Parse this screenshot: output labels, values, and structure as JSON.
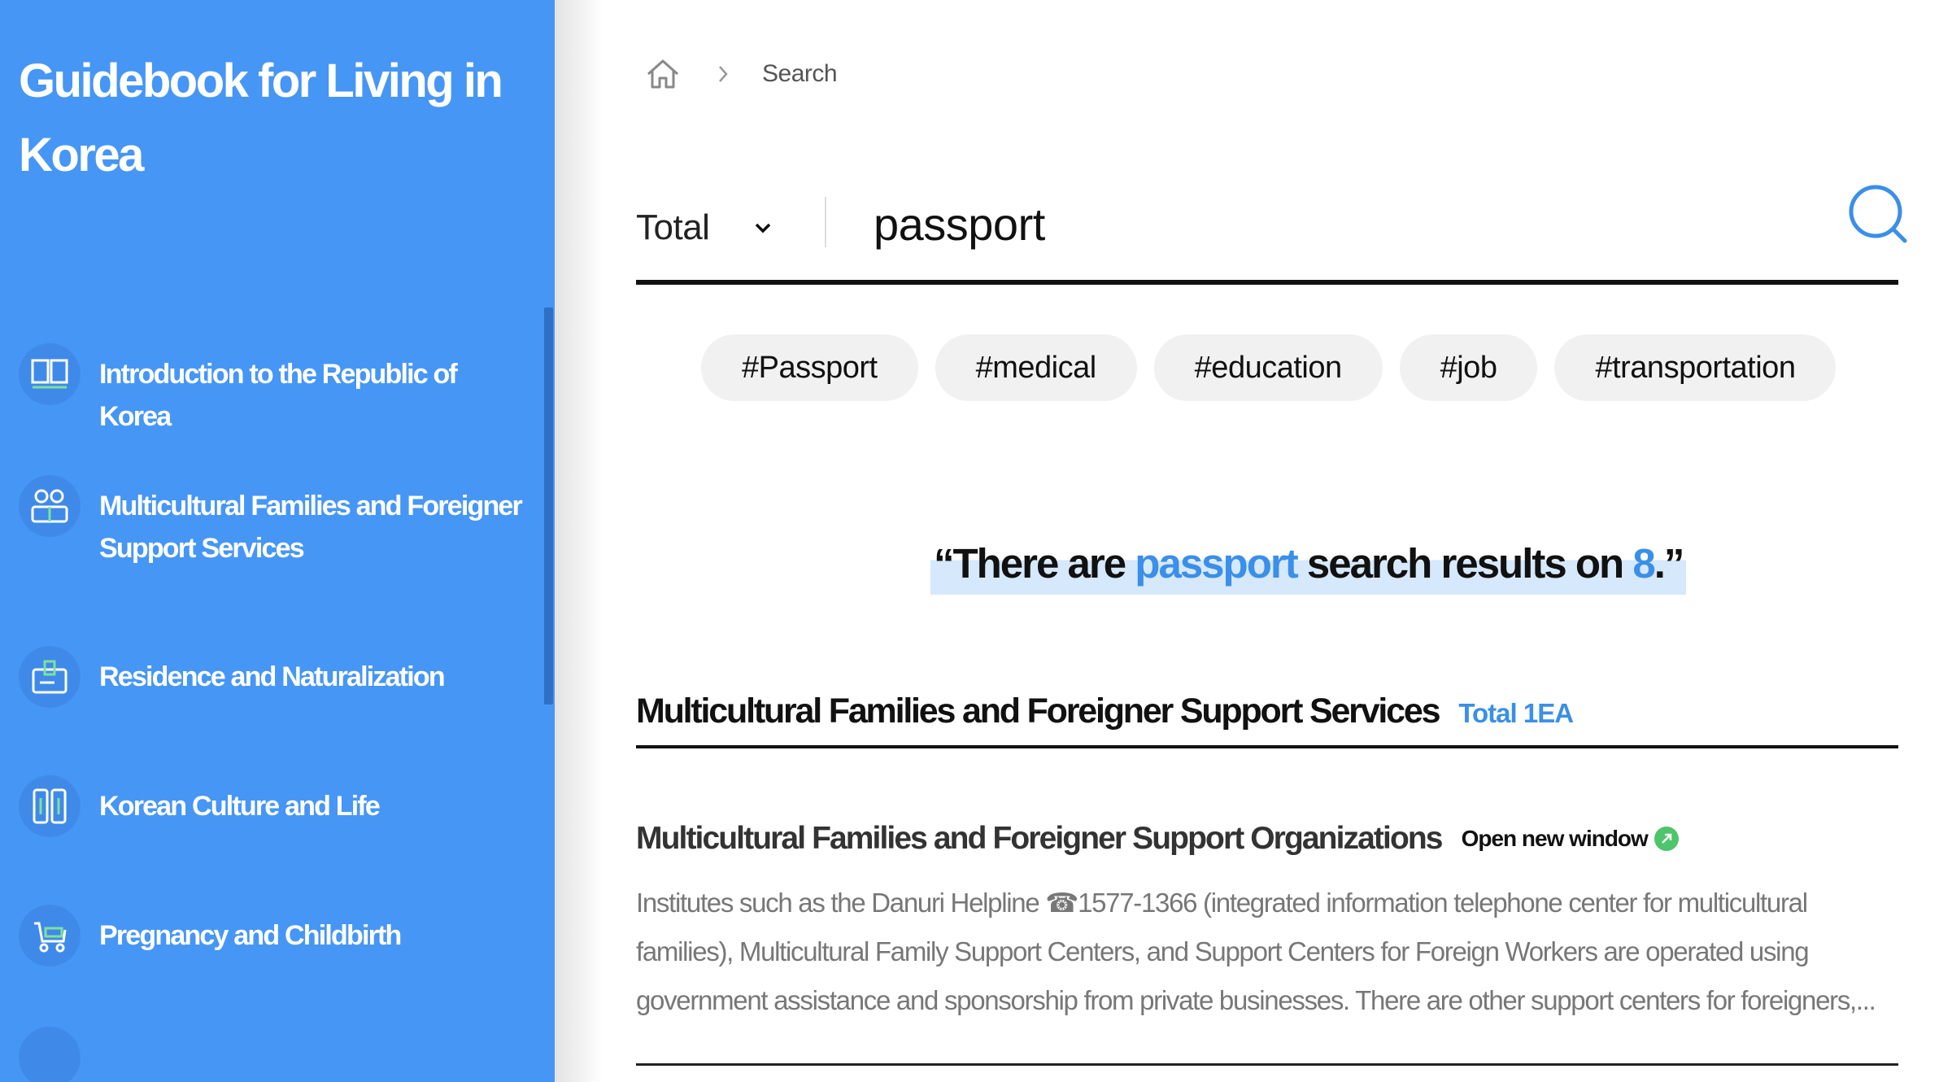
{
  "sidebar": {
    "title": "Guidebook for Living in Korea",
    "items": [
      {
        "label": "Introduction to the Republic of Korea",
        "icon": "book-icon"
      },
      {
        "label": "Multicultural Families and Foreigner Support Services",
        "icon": "people-icon"
      },
      {
        "label": "Residence and Naturalization",
        "icon": "id-card-icon"
      },
      {
        "label": "Korean Culture and Life",
        "icon": "culture-icon"
      },
      {
        "label": "Pregnancy and Childbirth",
        "icon": "stroller-icon"
      }
    ]
  },
  "breadcrumb": {
    "home_icon": "home-icon",
    "current": "Search"
  },
  "search": {
    "scope": "Total",
    "query": "passport",
    "button_icon": "search-icon"
  },
  "tags": [
    "#Passport",
    "#medical",
    "#education",
    "#job",
    "#transportation"
  ],
  "summary": {
    "prefix": "“There are ",
    "keyword": "passport",
    "middle": " search results on ",
    "count": "8",
    "suffix": ".”"
  },
  "section": {
    "title": "Multicultural Families and Foreigner Support Services",
    "count": "Total 1EA"
  },
  "result": {
    "title": "Multicultural Families and Foreigner Support Organizations",
    "open_new": "Open new window",
    "description": "Institutes such as the Danuri Helpline ☎1577-1366 (integrated information telephone center for multicultural families), Multicultural Family Support Centers, and Support Centers for Foreign Workers are operated using government assistance and sponsorship from private businesses. There are other support centers for foreigners,..."
  },
  "colors": {
    "sidebar_bg": "#4696f5",
    "accent": "#3a8fe8",
    "highlight": "#d6e8fb",
    "open_new_icon": "#4ec46b"
  }
}
